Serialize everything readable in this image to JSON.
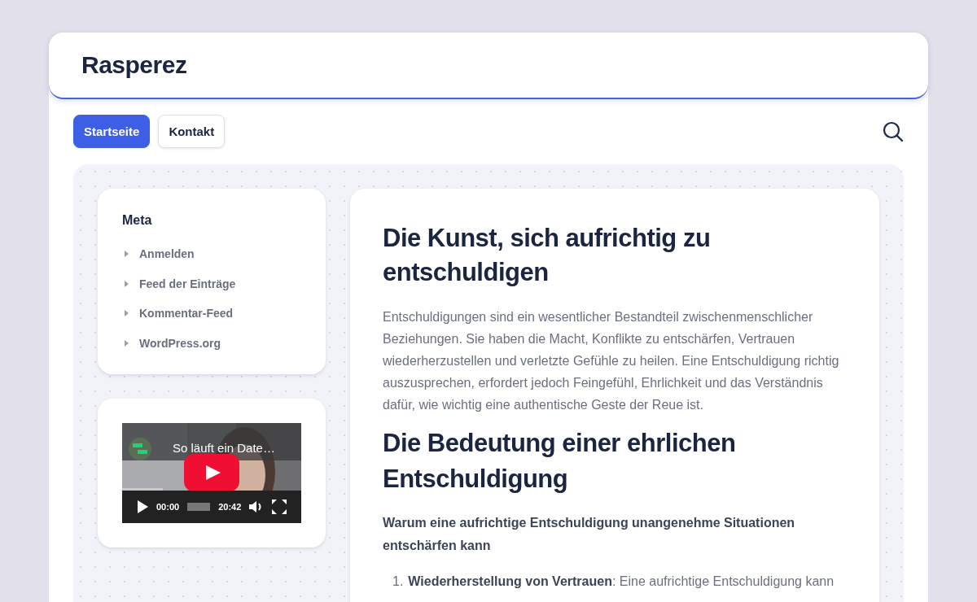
{
  "site": {
    "title": "Rasperez"
  },
  "nav": [
    {
      "label": "Startseite",
      "selected": true
    },
    {
      "label": "Kontakt",
      "selected": false
    }
  ],
  "sidebar": {
    "meta": {
      "title": "Meta",
      "items": [
        "Anmelden",
        "Feed der Einträge",
        "Kommentar-Feed",
        "WordPress.org"
      ]
    },
    "video": {
      "title": "So läuft ein Date…",
      "time": "00:00",
      "duration": "20:42",
      "level": 0
    }
  },
  "article": {
    "title": "Die Kunst, sich aufrichtig zu entschuldigen",
    "intro": "Entschuldigungen sind ein wesentlicher Bestandteil zwischenmenschlicher Beziehungen. Sie haben die Macht, Konflikte zu entschärfen, Vertrauen wiederherzustellen und verletzte Gefühle zu heilen. Eine Entschuldigung richtig auszusprechen, erfordert jedoch Feingefühl, Ehrlichkeit und das Verständnis dafür, wie wichtig eine authentische Geste der Reue ist.",
    "subtitle": "Die Bedeutung einer ehrlichen Entschuldigung",
    "lead": "Warum eine aufrichtige Entschuldigung unangenehme Situationen entschärfen kann",
    "list": [
      {
        "number": "1.",
        "text": "**Wiederherstellung von Vertrauen**: Eine aufrichtige Entschuldigung kann"
      }
    ]
  }
}
